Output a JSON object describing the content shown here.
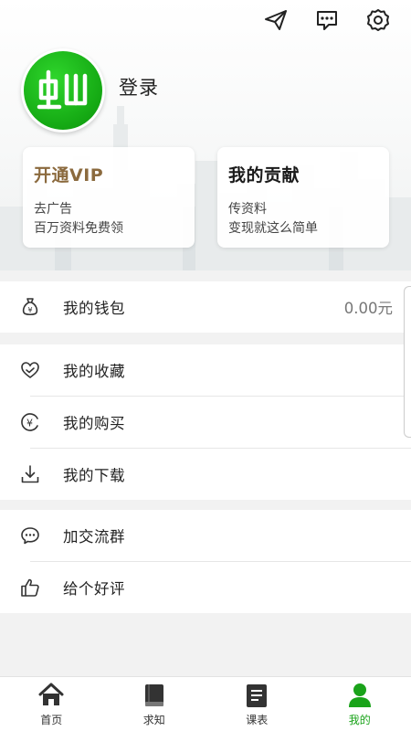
{
  "header": {
    "icons": [
      "send-icon",
      "message-icon",
      "settings-icon"
    ],
    "login_label": "登录"
  },
  "cards": {
    "vip": {
      "title": "开通VIP",
      "line1": "去广告",
      "line2": "百万资料免费领"
    },
    "contribution": {
      "title": "我的贡献",
      "line1": "传资料",
      "line2": "变现就这么简单"
    }
  },
  "menu": {
    "wallet": {
      "label": "我的钱包",
      "value": "0.00元"
    },
    "favorites": {
      "label": "我的收藏"
    },
    "purchases": {
      "label": "我的购买"
    },
    "downloads": {
      "label": "我的下载"
    },
    "join_group": {
      "label": "加交流群"
    },
    "rate": {
      "label": "给个好评"
    }
  },
  "tabs": [
    {
      "label": "首页",
      "icon": "home-icon"
    },
    {
      "label": "求知",
      "icon": "book-icon"
    },
    {
      "label": "课表",
      "icon": "schedule-icon"
    },
    {
      "label": "我的",
      "icon": "profile-icon",
      "active": true
    }
  ],
  "colors": {
    "accent": "#1aa31a",
    "vip_gold": "#8b6a3e"
  }
}
